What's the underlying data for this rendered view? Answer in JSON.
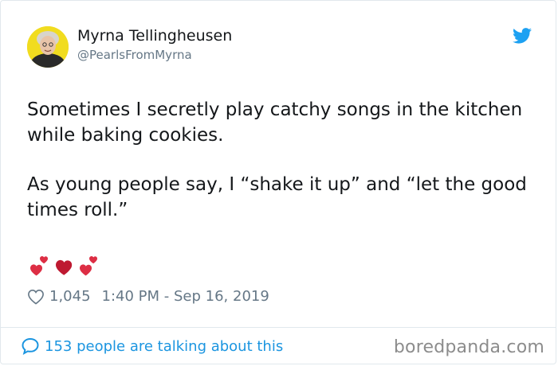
{
  "tweet": {
    "author_name": "Myrna Tellingheusen",
    "author_handle": "@PearlsFromMyrna",
    "paragraphs": [
      "Sometimes I secretly play catchy songs in the kitchen while baking cookies.",
      "As young people say, I “shake it up” and “let the good times roll.”"
    ],
    "emoji": [
      "two-hearts-icon",
      "red-heart-icon",
      "two-hearts-icon"
    ],
    "likes": "1,045",
    "timestamp": "1:40 PM - Sep 16, 2019",
    "talking": "153 people are talking about this"
  },
  "watermark": "boredpanda.com",
  "colors": {
    "twitter_blue": "#1da1f2",
    "link_blue": "#1b95e0",
    "muted": "#657786",
    "heart_red": "#dd2e44",
    "avatar_bg": "#f1dc1f"
  }
}
